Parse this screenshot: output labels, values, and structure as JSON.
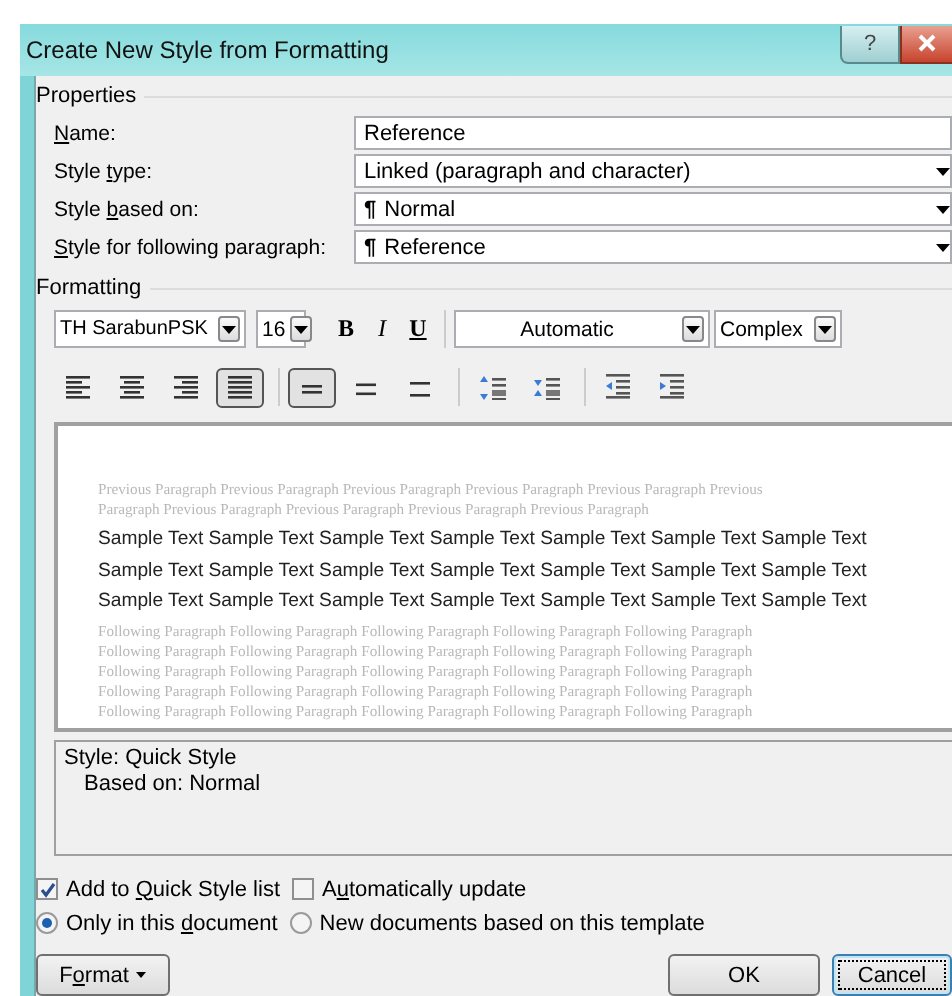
{
  "window": {
    "title": "Create New Style from Formatting",
    "help_glyph": "?"
  },
  "properties": {
    "heading": "Properties",
    "rows": [
      {
        "label": [
          {
            "text": "N",
            "underline": true
          },
          {
            "text": "ame:"
          }
        ],
        "kind": "text",
        "value": "Reference"
      },
      {
        "label": [
          {
            "text": "Style "
          },
          {
            "text": "t",
            "underline": true
          },
          {
            "text": "ype:"
          }
        ],
        "kind": "combo",
        "value": "Linked (paragraph and character)"
      },
      {
        "label": [
          {
            "text": "Style "
          },
          {
            "text": "b",
            "underline": true
          },
          {
            "text": "ased on:"
          }
        ],
        "kind": "combo",
        "mark": "¶",
        "value": "Normal"
      },
      {
        "label": [
          {
            "text": "S",
            "underline": true
          },
          {
            "text": "tyle for following paragraph:"
          }
        ],
        "kind": "combo",
        "mark": "¶",
        "value": "Reference"
      }
    ]
  },
  "formatting": {
    "heading": "Formatting",
    "font": "TH SarabunPSK",
    "size": "16",
    "styles": [
      {
        "kind": "bold",
        "glyph": "B"
      },
      {
        "kind": "italic",
        "glyph": "I"
      },
      {
        "kind": "underline",
        "glyph": "U"
      }
    ],
    "font_colour_choice": "Automatic",
    "script": "Complex",
    "alignment": [
      {
        "kind": "left",
        "selected": false
      },
      {
        "kind": "center",
        "selected": false
      },
      {
        "kind": "right",
        "selected": false
      },
      {
        "kind": "justify",
        "selected": true
      }
    ],
    "spacing": [
      {
        "kind": "single",
        "selected": true
      },
      {
        "kind": "one-half",
        "selected": false
      },
      {
        "kind": "double",
        "selected": false
      }
    ],
    "paragraph_spacing": [
      {
        "kind": "increase"
      },
      {
        "kind": "decrease"
      }
    ],
    "indent": [
      {
        "kind": "decrease"
      },
      {
        "kind": "increase"
      }
    ]
  },
  "preview": {
    "previous": [
      "Previous Paragraph Previous Paragraph Previous Paragraph Previous Paragraph Previous Paragraph Previous",
      "Paragraph Previous Paragraph Previous Paragraph Previous Paragraph Previous Paragraph"
    ],
    "sample": [
      "Sample Text Sample Text Sample Text Sample Text Sample Text Sample Text Sample Text",
      "Sample Text Sample Text Sample Text Sample Text Sample Text Sample Text Sample Text",
      "Sample Text Sample Text Sample Text Sample Text Sample Text Sample Text Sample Text"
    ],
    "following": [
      "Following Paragraph Following Paragraph Following Paragraph Following Paragraph Following Paragraph",
      "Following Paragraph Following Paragraph Following Paragraph Following Paragraph Following Paragraph",
      "Following Paragraph Following Paragraph Following Paragraph Following Paragraph Following Paragraph",
      "Following Paragraph Following Paragraph Following Paragraph Following Paragraph Following Paragraph",
      "Following Paragraph Following Paragraph Following Paragraph Following Paragraph Following Paragraph"
    ]
  },
  "description": [
    "Style: Quick Style",
    "Based on: Normal"
  ],
  "options": {
    "checks": [
      {
        "label": [
          {
            "text": "Add to "
          },
          {
            "text": "Q",
            "underline": true
          },
          {
            "text": "uick Style list"
          }
        ],
        "checked": true
      },
      {
        "label": [
          {
            "text": "A"
          },
          {
            "text": "u",
            "underline": true
          },
          {
            "text": "tomatically update"
          }
        ],
        "checked": false
      }
    ],
    "radios": [
      {
        "label": [
          {
            "text": "Only in this "
          },
          {
            "text": "d",
            "underline": true
          },
          {
            "text": "ocument"
          }
        ],
        "selected": true
      },
      {
        "label": [
          {
            "text": "New documents based on this template"
          }
        ],
        "selected": false
      }
    ]
  },
  "buttons": [
    {
      "kind": "menu",
      "label": [
        {
          "text": "F"
        },
        {
          "text": "o",
          "underline": true
        },
        {
          "text": "rmat"
        }
      ],
      "focused": false
    },
    {
      "kind": "plain",
      "label": [
        {
          "text": "OK"
        }
      ],
      "focused": false
    },
    {
      "kind": "plain",
      "label": [
        {
          "text": "Cancel"
        }
      ],
      "focused": true
    }
  ]
}
